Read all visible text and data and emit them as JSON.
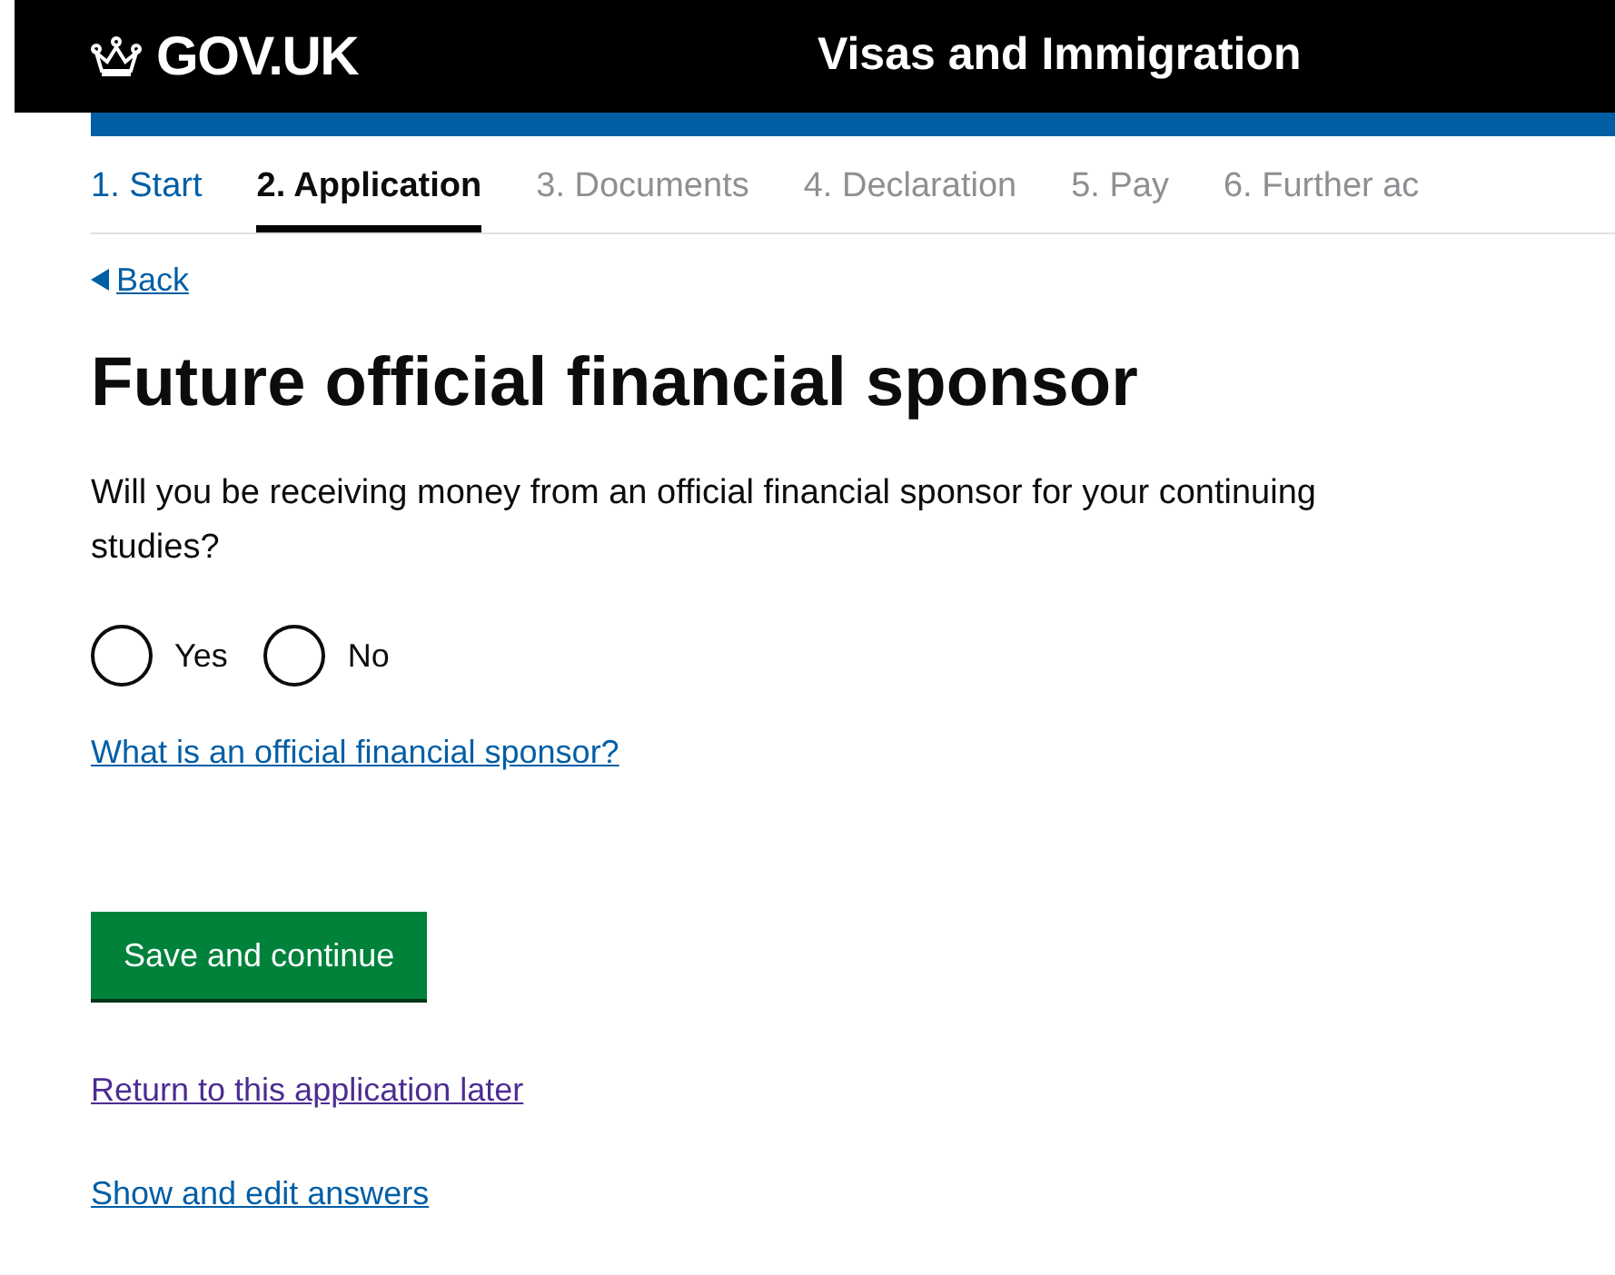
{
  "header": {
    "logo": "GOV.UK",
    "service": "Visas and Immigration"
  },
  "steps": [
    {
      "label": "1. Start",
      "completed": true,
      "selected": false
    },
    {
      "label": "2. Application",
      "completed": false,
      "selected": true
    },
    {
      "label": "3. Documents",
      "completed": false,
      "selected": false
    },
    {
      "label": "4. Declaration",
      "completed": false,
      "selected": false
    },
    {
      "label": "5. Pay",
      "completed": false,
      "selected": false
    },
    {
      "label": "6. Further ac",
      "completed": false,
      "selected": false
    }
  ],
  "back_link": "Back",
  "heading": "Future official financial sponsor",
  "question": "Will you be receiving money from an official financial sponsor for your continuing studies?",
  "options": [
    {
      "label": "Yes",
      "selected": false
    },
    {
      "label": "No",
      "selected": false
    }
  ],
  "help_link": "What is an official financial sponsor?",
  "submit_button": "Save and continue",
  "links": [
    {
      "label": "Return to this application later",
      "visited": true
    },
    {
      "label": "Show and edit answers",
      "visited": false
    }
  ]
}
